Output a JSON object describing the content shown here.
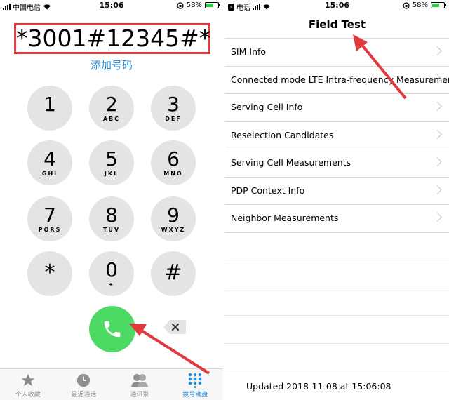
{
  "left": {
    "status": {
      "carrier": "中国电信",
      "time": "15:06",
      "battery": "58%"
    },
    "number": "*3001#12345#*",
    "add_number": "添加号码",
    "keys": [
      {
        "digit": "1",
        "letters": ""
      },
      {
        "digit": "2",
        "letters": "ABC"
      },
      {
        "digit": "3",
        "letters": "DEF"
      },
      {
        "digit": "4",
        "letters": "GHI"
      },
      {
        "digit": "5",
        "letters": "JKL"
      },
      {
        "digit": "6",
        "letters": "MNO"
      },
      {
        "digit": "7",
        "letters": "PQRS"
      },
      {
        "digit": "8",
        "letters": "TUV"
      },
      {
        "digit": "9",
        "letters": "WXYZ"
      },
      {
        "digit": "*",
        "letters": ""
      },
      {
        "digit": "0",
        "letters": "+"
      },
      {
        "digit": "#",
        "letters": ""
      }
    ],
    "tabs": [
      {
        "label": "个人收藏",
        "icon": "star-icon"
      },
      {
        "label": "最近通话",
        "icon": "clock-icon"
      },
      {
        "label": "通讯录",
        "icon": "contacts-icon"
      },
      {
        "label": "拨号键盘",
        "icon": "keypad-icon"
      }
    ]
  },
  "right": {
    "status": {
      "carrier": "电话",
      "time": "15:06",
      "battery": "58%"
    },
    "title": "Field Test",
    "items": [
      "SIM Info",
      "Connected mode LTE Intra-frequency Measurement",
      "Serving Cell Info",
      "Reselection Candidates",
      "Serving Cell Measurements",
      "PDP Context Info",
      "Neighbor Measurements"
    ],
    "updated": "Updated 2018-11-08 at 15:06:08"
  },
  "colors": {
    "accent": "#2a8ed8",
    "call": "#4cd964",
    "highlight": "#e0393e"
  }
}
